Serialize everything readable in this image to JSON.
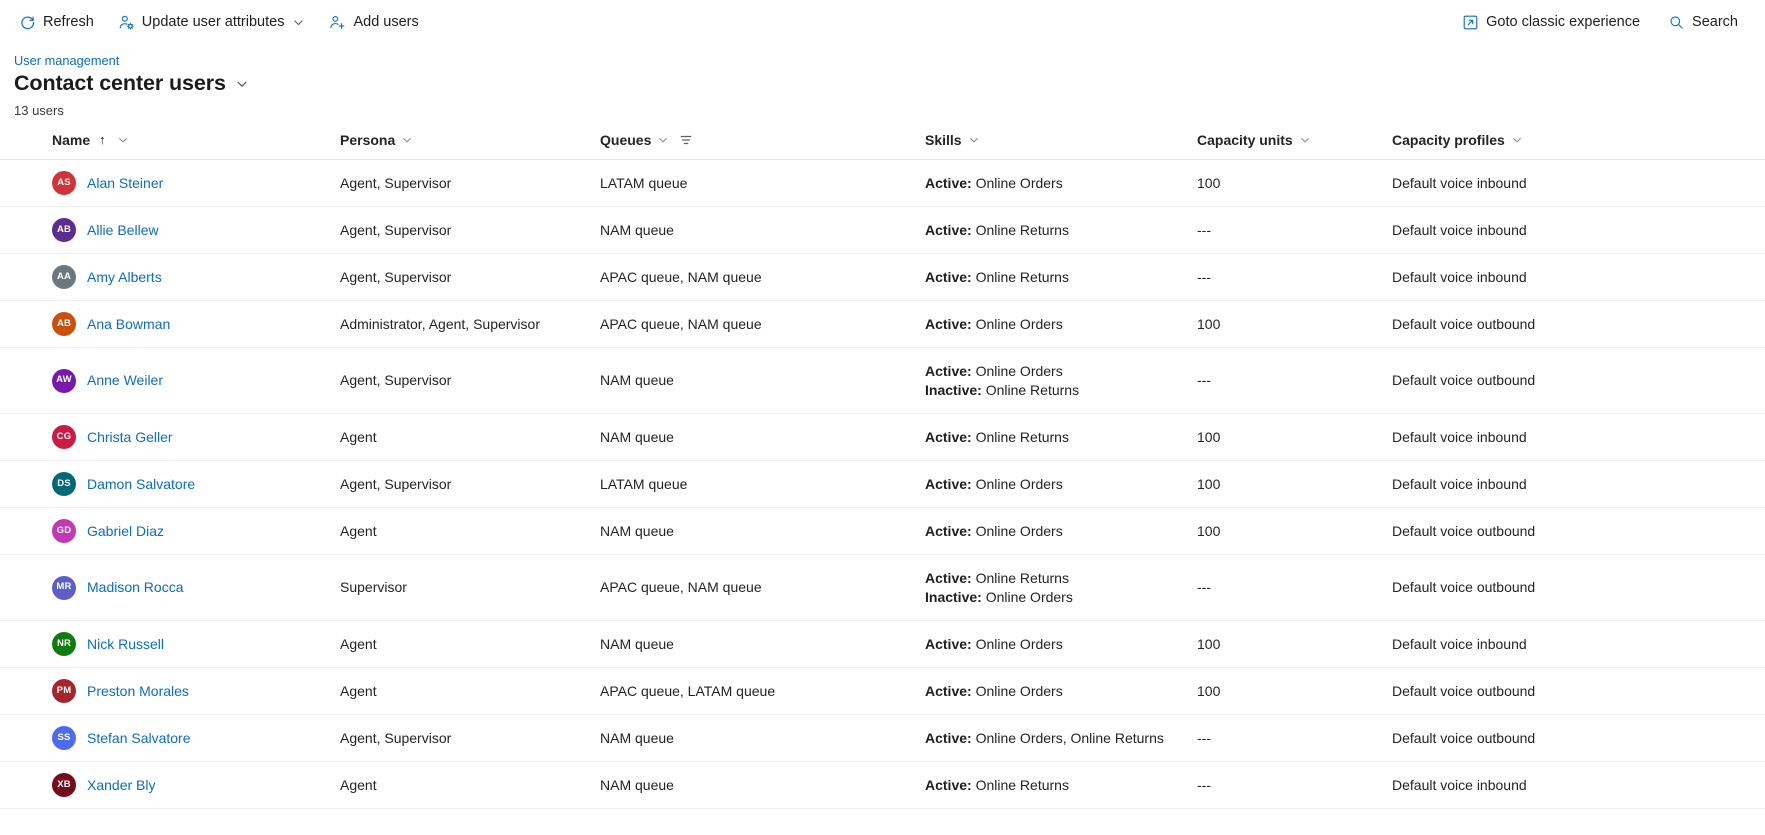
{
  "toolbar": {
    "refresh_label": "Refresh",
    "update_attributes_label": "Update user attributes",
    "add_users_label": "Add users",
    "goto_classic_label": "Goto classic experience",
    "search_label": "Search",
    "accent_color": "#0f6cbd"
  },
  "header": {
    "breadcrumb": "User management",
    "title": "Contact center users",
    "count": "13 users"
  },
  "table": {
    "columns": [
      {
        "label": "Name",
        "sort": "↑",
        "has_chevron": true,
        "has_filter": false
      },
      {
        "label": "Persona",
        "sort": "",
        "has_chevron": true,
        "has_filter": false
      },
      {
        "label": "Queues",
        "sort": "",
        "has_chevron": true,
        "has_filter": true
      },
      {
        "label": "Skills",
        "sort": "",
        "has_chevron": true,
        "has_filter": false
      },
      {
        "label": "Capacity units",
        "sort": "",
        "has_chevron": true,
        "has_filter": false
      },
      {
        "label": "Capacity profiles",
        "sort": "",
        "has_chevron": true,
        "has_filter": false
      }
    ],
    "rows": [
      {
        "initials": "AS",
        "avatar_color": "#d13438",
        "name": "Alan Steiner",
        "persona": "Agent, Supervisor",
        "queues": "LATAM queue",
        "skills": [
          {
            "label": "Active:",
            "value": "Online Orders"
          }
        ],
        "capacity_units": "100",
        "capacity_profiles": "Default voice inbound"
      },
      {
        "initials": "AB",
        "avatar_color": "#5c2d91",
        "name": "Allie Bellew",
        "persona": "Agent, Supervisor",
        "queues": "NAM queue",
        "skills": [
          {
            "label": "Active:",
            "value": "Online Returns"
          }
        ],
        "capacity_units": "---",
        "capacity_profiles": "Default voice inbound"
      },
      {
        "initials": "AA",
        "avatar_color": "#69797e",
        "name": "Amy Alberts",
        "persona": "Agent, Supervisor",
        "queues": "APAC queue, NAM queue",
        "skills": [
          {
            "label": "Active:",
            "value": "Online Returns"
          }
        ],
        "capacity_units": "---",
        "capacity_profiles": "Default voice inbound"
      },
      {
        "initials": "AB",
        "avatar_color": "#ca5010",
        "name": "Ana Bowman",
        "persona": "Administrator, Agent, Supervisor",
        "queues": "APAC queue, NAM queue",
        "skills": [
          {
            "label": "Active:",
            "value": "Online Orders"
          }
        ],
        "capacity_units": "100",
        "capacity_profiles": "Default voice outbound"
      },
      {
        "initials": "AW",
        "avatar_color": "#7719aa",
        "name": "Anne Weiler",
        "persona": "Agent, Supervisor",
        "queues": "NAM queue",
        "skills": [
          {
            "label": "Active:",
            "value": "Online Orders"
          },
          {
            "label": "Inactive:",
            "value": "Online Returns"
          }
        ],
        "capacity_units": "---",
        "capacity_profiles": "Default voice outbound"
      },
      {
        "initials": "CG",
        "avatar_color": "#c91b45",
        "name": "Christa Geller",
        "persona": "Agent",
        "queues": "NAM queue",
        "skills": [
          {
            "label": "Active:",
            "value": "Online Returns"
          }
        ],
        "capacity_units": "100",
        "capacity_profiles": "Default voice inbound"
      },
      {
        "initials": "DS",
        "avatar_color": "#006974",
        "name": "Damon Salvatore",
        "persona": "Agent, Supervisor",
        "queues": "LATAM queue",
        "skills": [
          {
            "label": "Active:",
            "value": "Online Orders"
          }
        ],
        "capacity_units": "100",
        "capacity_profiles": "Default voice inbound"
      },
      {
        "initials": "GD",
        "avatar_color": "#c239b3",
        "name": "Gabriel Diaz",
        "persona": "Agent",
        "queues": "NAM queue",
        "skills": [
          {
            "label": "Active:",
            "value": "Online Orders"
          }
        ],
        "capacity_units": "100",
        "capacity_profiles": "Default voice outbound"
      },
      {
        "initials": "MR",
        "avatar_color": "#5b5fc7",
        "name": "Madison Rocca",
        "persona": "Supervisor",
        "queues": "APAC queue, NAM queue",
        "skills": [
          {
            "label": "Active:",
            "value": "Online Returns"
          },
          {
            "label": "Inactive:",
            "value": "Online Orders"
          }
        ],
        "capacity_units": "---",
        "capacity_profiles": "Default voice outbound"
      },
      {
        "initials": "NR",
        "avatar_color": "#107c10",
        "name": "Nick Russell",
        "persona": "Agent",
        "queues": "NAM queue",
        "skills": [
          {
            "label": "Active:",
            "value": "Online Orders"
          }
        ],
        "capacity_units": "100",
        "capacity_profiles": "Default voice inbound"
      },
      {
        "initials": "PM",
        "avatar_color": "#a4262c",
        "name": "Preston Morales",
        "persona": "Agent",
        "queues": "APAC queue, LATAM queue",
        "skills": [
          {
            "label": "Active:",
            "value": "Online Orders"
          }
        ],
        "capacity_units": "100",
        "capacity_profiles": "Default voice outbound"
      },
      {
        "initials": "SS",
        "avatar_color": "#4f6bed",
        "name": "Stefan Salvatore",
        "persona": "Agent, Supervisor",
        "queues": "NAM queue",
        "skills": [
          {
            "label": "Active:",
            "value": "Online Orders, Online Returns"
          }
        ],
        "capacity_units": "---",
        "capacity_profiles": "Default voice outbound"
      },
      {
        "initials": "XB",
        "avatar_color": "#750b1c",
        "name": "Xander Bly",
        "persona": "Agent",
        "queues": "NAM queue",
        "skills": [
          {
            "label": "Active:",
            "value": "Online Returns"
          }
        ],
        "capacity_units": "---",
        "capacity_profiles": "Default voice inbound"
      }
    ]
  }
}
